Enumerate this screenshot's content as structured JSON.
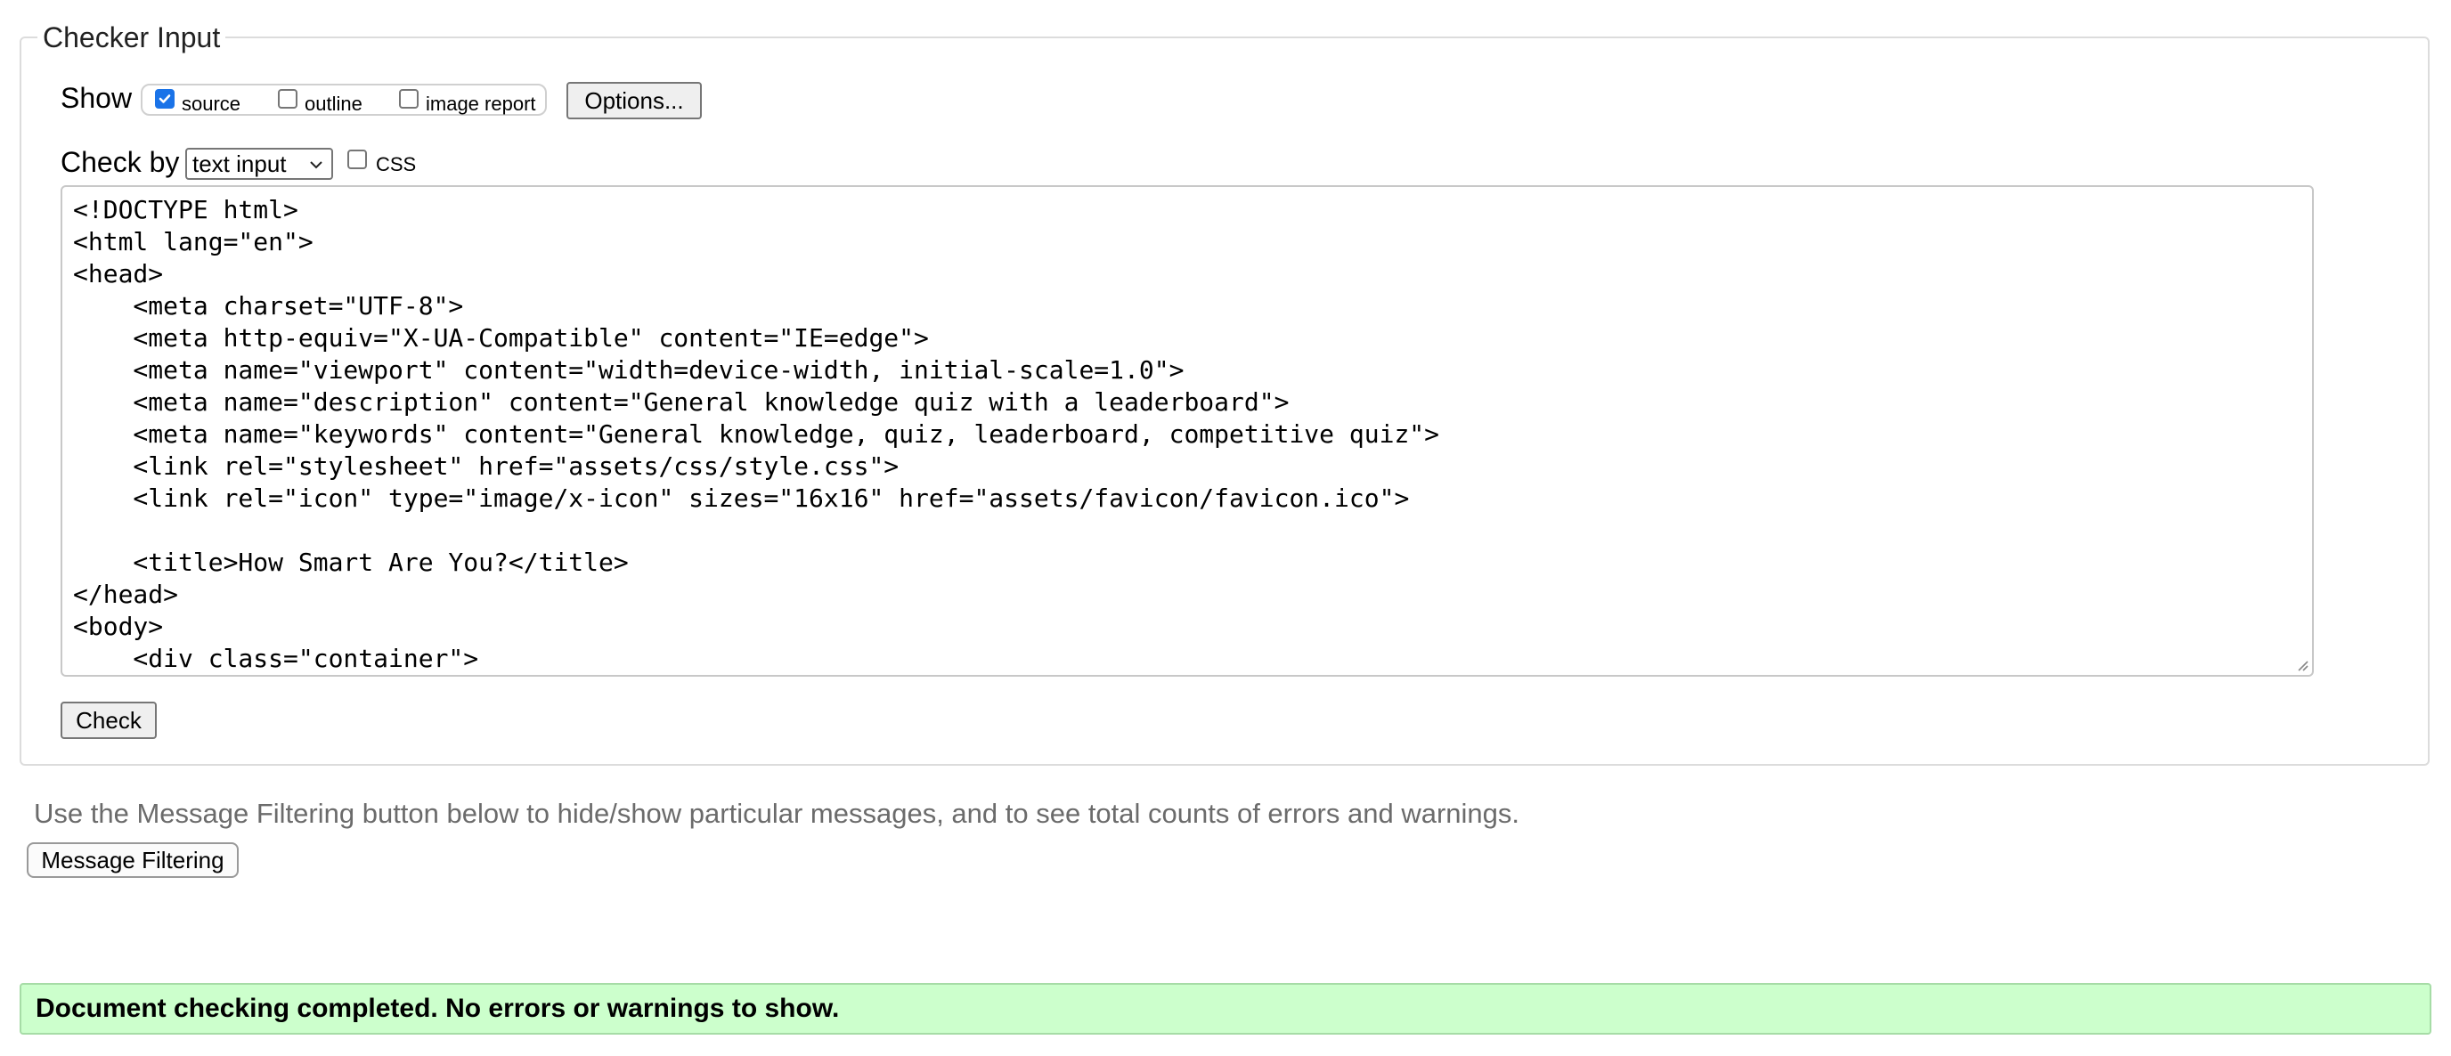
{
  "fieldset": {
    "legend": "Checker Input"
  },
  "show": {
    "label": "Show",
    "options": [
      {
        "label": "source",
        "checked": true
      },
      {
        "label": "outline",
        "checked": false
      },
      {
        "label": "image report",
        "checked": false
      }
    ],
    "options_button": "Options..."
  },
  "check_by": {
    "label": "Check by",
    "selected": "text input",
    "css_label": "CSS",
    "css_checked": false
  },
  "textarea": {
    "lines": [
      "<!DOCTYPE html>",
      "<html lang=\"en\">",
      "<head>",
      "    <meta charset=\"UTF-8\">",
      "    <meta http-equiv=\"X-UA-Compatible\" content=\"IE=edge\">",
      "    <meta name=\"viewport\" content=\"width=device-width, initial-scale=1.0\">",
      "    <meta name=\"description\" content=\"General knowledge quiz with a leaderboard\">",
      "    <meta name=\"keywords\" content=\"General knowledge, quiz, leaderboard, competitive quiz\">",
      "    <link rel=\"stylesheet\" href=\"assets/css/style.css\">",
      "    <link rel=\"icon\" type=\"image/x-icon\" sizes=\"16x16\" href=\"assets/favicon/favicon.ico\">",
      "",
      "    <title>How Smart Are You?</title>",
      "</head>",
      "<body>",
      "    <div class=\"container\">"
    ]
  },
  "check_button": "Check",
  "hint": "Use the Message Filtering button below to hide/show particular messages, and to see total counts of errors and warnings.",
  "message_filtering_button": "Message Filtering",
  "status": "Document checking completed. No errors or warnings to show.",
  "colors": {
    "success_bg": "#ccffcc",
    "checkbox_accent": "#1a73e8",
    "hint_text": "#6b6b6b"
  }
}
